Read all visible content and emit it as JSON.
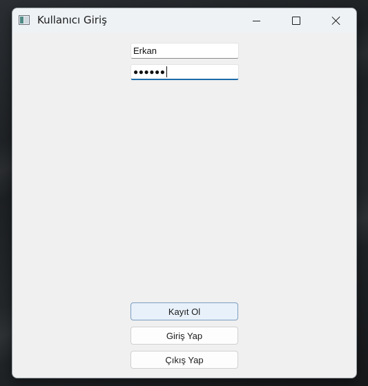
{
  "window": {
    "title": "Kullanıcı Giriş"
  },
  "form": {
    "username_value": "Erkan",
    "password_masked": "●●●●●●"
  },
  "buttons": {
    "register_label": "Kayıt Ol",
    "login_label": "Giriş Yap",
    "exit_label": "Çıkış Yap"
  },
  "icons": {
    "app": "app-window-icon",
    "minimize": "minimize-icon",
    "maximize": "maximize-icon",
    "close": "close-icon"
  },
  "colors": {
    "focus_accent": "#1b6aa8",
    "default_button_tint": "#e8f1fa"
  }
}
